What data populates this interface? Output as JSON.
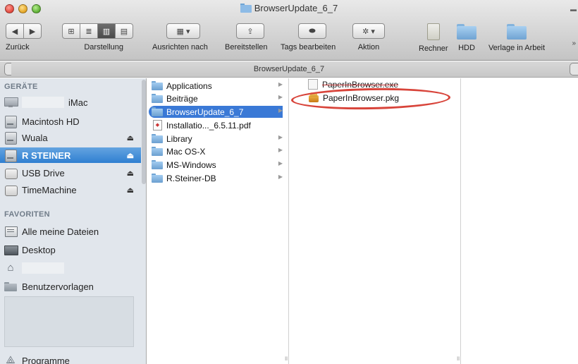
{
  "window": {
    "title": "BrowserUpdate_6_7"
  },
  "toolbar": {
    "back_label": "Zurück",
    "view_label": "Darstellung",
    "arrange_label": "Ausrichten nach",
    "share_label": "Bereitstellen",
    "tags_label": "Tags bearbeiten",
    "action_label": "Aktion",
    "fav1_label": "Rechner",
    "fav2_label": "HDD",
    "fav3_label": "Verlage in Arbeit"
  },
  "pathbar": {
    "title": "BrowserUpdate_6_7"
  },
  "sidebar": {
    "devices_header": "GERÄTE",
    "devices": [
      {
        "label": "iMac",
        "icon": "monitor-icon"
      },
      {
        "label": "Macintosh HD",
        "icon": "hard-disk-icon"
      },
      {
        "label": "Wuala",
        "icon": "disk-icon",
        "eject": "⏏"
      },
      {
        "label": "R STEINER",
        "icon": "disk-icon",
        "eject": "⏏",
        "selected": true
      },
      {
        "label": "USB Drive",
        "icon": "usb-drive-icon",
        "eject": "⏏"
      },
      {
        "label": "TimeMachine",
        "icon": "usb-drive-icon",
        "eject": "⏏"
      }
    ],
    "favorites_header": "FAVORITEN",
    "favorites": [
      {
        "label": "Alle meine Dateien",
        "icon": "all-files-icon"
      },
      {
        "label": "Desktop",
        "icon": "desktop-icon"
      },
      {
        "label": "",
        "icon": "home-icon"
      },
      {
        "label": "Benutzervorlagen",
        "icon": "folder-icon"
      }
    ],
    "bottom_item": {
      "label": "Programme",
      "icon": "applications-icon"
    }
  },
  "column1": {
    "items": [
      {
        "label": "Applications",
        "type": "folder",
        "has_children": true
      },
      {
        "label": "Beiträge",
        "type": "folder",
        "has_children": true
      },
      {
        "label": "BrowserUpdate_6_7",
        "type": "folder",
        "has_children": true,
        "selected": true
      },
      {
        "label": "Installatio..._6.5.11.pdf",
        "type": "pdf",
        "has_children": false
      },
      {
        "label": "Library",
        "type": "folder",
        "has_children": true
      },
      {
        "label": "Mac OS-X",
        "type": "folder",
        "has_children": true
      },
      {
        "label": "MS-Windows",
        "type": "folder",
        "has_children": true
      },
      {
        "label": "R.Steiner-DB",
        "type": "folder",
        "has_children": true
      }
    ],
    "arrow": "▶"
  },
  "column2": {
    "items": [
      {
        "label": "PaperInBrowser.exe",
        "type": "exe"
      },
      {
        "label": "PaperInBrowser.pkg",
        "type": "pkg"
      }
    ]
  },
  "annotation": {
    "color": "#d8443a"
  },
  "colors": {
    "selection": "#3a79d6",
    "sidebar_bg": "#e1e6ec"
  }
}
